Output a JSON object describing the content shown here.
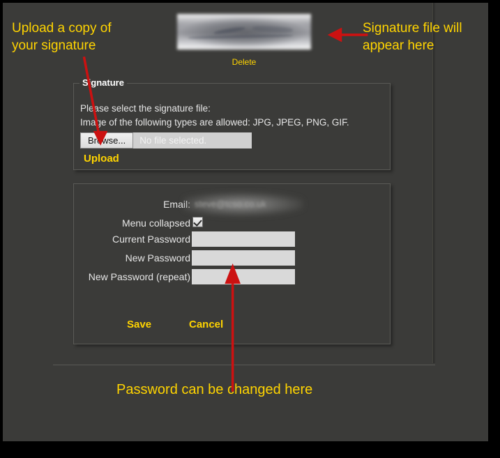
{
  "annotations": {
    "upload": "Upload a copy of\nyour signature",
    "signature_file": "Signature file will\nappear here",
    "password": "Password can be changed here"
  },
  "signature_preview": {
    "delete_label": "Delete",
    "alt": "blurred-signature-image"
  },
  "signature_panel": {
    "legend": "Signature",
    "hint_line_1": "Please select the signature file:",
    "hint_line_2": "Image of the following types are allowed: JPG, JPEG, PNG, GIF.",
    "browse_label": "Browse...",
    "file_chosen": "No file selected.",
    "upload_label": "Upload"
  },
  "account_panel": {
    "rows": [
      {
        "label": "Email:",
        "value": "steve@tcso.co.uk",
        "type": "blurred-text"
      },
      {
        "label": "Menu collapsed",
        "value": "checked",
        "type": "checkbox"
      },
      {
        "label": "Current Password",
        "value": "",
        "type": "password"
      },
      {
        "label": "New Password",
        "value": "",
        "type": "password"
      },
      {
        "label": "New Password (repeat)",
        "value": "",
        "type": "password"
      }
    ],
    "save_label": "Save",
    "cancel_label": "Cancel"
  },
  "colors": {
    "page_background": "#3b3b39",
    "frame": "#000000",
    "accent_yellow": "#ffd400",
    "annotation_arrow_red": "#cc1111",
    "panel_border": "#5b5b57",
    "input_background": "#d9d9d9",
    "text_light": "#e6e6e6",
    "legend_white": "#ffffff"
  }
}
